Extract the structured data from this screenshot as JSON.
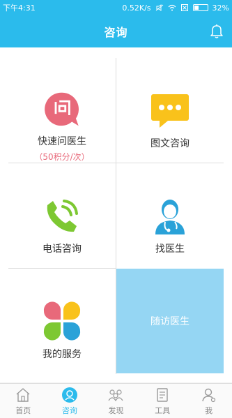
{
  "status_bar": {
    "time": "下午4:31",
    "network_speed": "0.52K/s",
    "battery_level": 0.32,
    "battery_text": "32%"
  },
  "header": {
    "title": "咨询"
  },
  "services": [
    {
      "label": "快速问医生",
      "sub": "（50积分/次）",
      "icon": "quick-ask-icon",
      "color": "#e8697a"
    },
    {
      "label": "图文咨询",
      "icon": "chat-bubble-icon",
      "color": "#f9c21b"
    },
    {
      "label": "电话咨询",
      "icon": "phone-icon",
      "color": "#7dc832"
    },
    {
      "label": "找医生",
      "icon": "doctor-icon",
      "color": "#2aa2d8"
    },
    {
      "label": "我的服务",
      "icon": "clover-icon",
      "color": "#e8697a"
    },
    {
      "label": "随访医生"
    }
  ],
  "tabbar": {
    "items": [
      {
        "label": "首页",
        "icon": "home-icon"
      },
      {
        "label": "咨询",
        "icon": "consult-icon",
        "active": true
      },
      {
        "label": "发现",
        "icon": "discover-icon"
      },
      {
        "label": "工具",
        "icon": "tools-icon"
      },
      {
        "label": "我",
        "icon": "profile-icon"
      }
    ]
  },
  "colors": {
    "primary": "#2bbbec",
    "followup_bg": "#95d6f3",
    "sub_text": "#e8697a"
  }
}
